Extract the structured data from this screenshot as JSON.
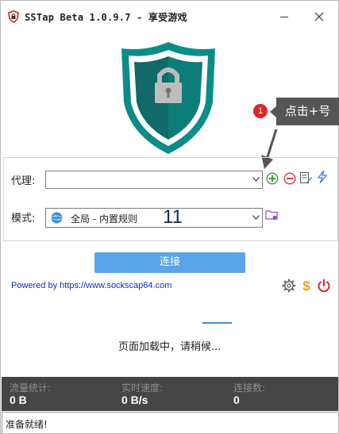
{
  "window": {
    "title": "SSTap Beta 1.0.9.7 - 享受游戏",
    "min_icon": "minimize-icon",
    "close_icon": "close-icon"
  },
  "tooltip": {
    "badge": "1",
    "text": "点击+号"
  },
  "proxy": {
    "label": "代理:",
    "value": ""
  },
  "mode": {
    "label": "模式:",
    "value": "全局 - 内置规则",
    "overlay_number": "11"
  },
  "toolbar_icons": [
    "add-icon",
    "remove-icon",
    "edit-icon",
    "flash-icon"
  ],
  "connect_label": "连接",
  "powered_by": "Powered by https://www.sockscap64.com",
  "loading_text": "页面加载中，请稍候...",
  "stats": {
    "traffic_label": "流量统计:",
    "traffic_value": "0 B",
    "speed_label": "实时速度:",
    "speed_value": "0 B/s",
    "connections_label": "连接数:",
    "connections_value": "0"
  },
  "status": "准备就绪!",
  "colors": {
    "shield": "#0c8c88",
    "connect_button": "#5aa4ea",
    "stats_bg": "#454545",
    "badge": "#e0242a",
    "tooltip_bg": "#555555"
  }
}
